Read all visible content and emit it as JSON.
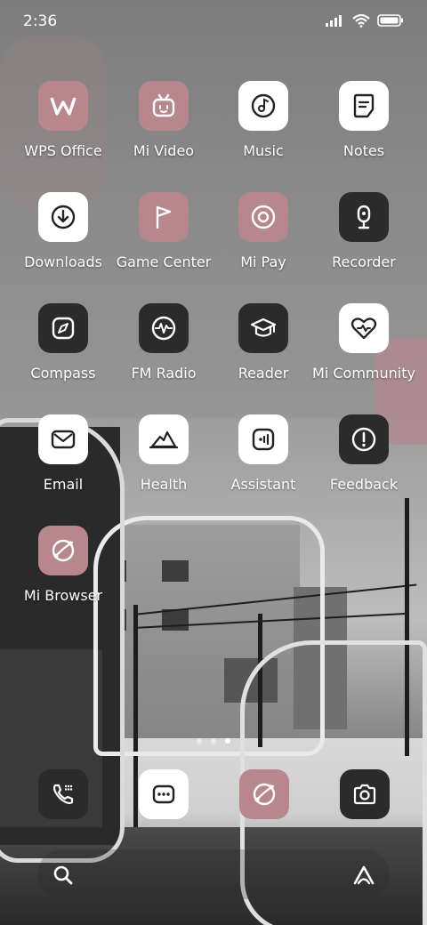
{
  "status_bar": {
    "time": "2:36"
  },
  "apps": [
    {
      "label": "WPS Office",
      "icon": "wps-office-icon",
      "style": "pink"
    },
    {
      "label": "Mi Video",
      "icon": "mi-video-icon",
      "style": "pink"
    },
    {
      "label": "Music",
      "icon": "music-icon",
      "style": "white"
    },
    {
      "label": "Notes",
      "icon": "notes-icon",
      "style": "white"
    },
    {
      "label": "Downloads",
      "icon": "downloads-icon",
      "style": "white"
    },
    {
      "label": "Game Center",
      "icon": "game-center-icon",
      "style": "pink"
    },
    {
      "label": "Mi Pay",
      "icon": "mi-pay-icon",
      "style": "pink"
    },
    {
      "label": "Recorder",
      "icon": "recorder-icon",
      "style": "dark"
    },
    {
      "label": "Compass",
      "icon": "compass-icon",
      "style": "dark"
    },
    {
      "label": "FM Radio",
      "icon": "fm-radio-icon",
      "style": "dark"
    },
    {
      "label": "Reader",
      "icon": "reader-icon",
      "style": "dark"
    },
    {
      "label": "Mi Community",
      "icon": "mi-community-icon",
      "style": "white"
    },
    {
      "label": "Email",
      "icon": "email-icon",
      "style": "white"
    },
    {
      "label": "Health",
      "icon": "health-icon",
      "style": "white"
    },
    {
      "label": "Assistant",
      "icon": "assistant-icon",
      "style": "white"
    },
    {
      "label": "Feedback",
      "icon": "feedback-icon",
      "style": "dark"
    },
    {
      "label": "Mi Browser",
      "icon": "mi-browser-icon",
      "style": "pink"
    }
  ],
  "page_indicator": {
    "pages": 3,
    "active_index": 2
  },
  "dock": [
    {
      "icon": "phone-icon",
      "style": "dark"
    },
    {
      "icon": "messaging-icon",
      "style": "white"
    },
    {
      "icon": "browser-icon",
      "style": "pink"
    },
    {
      "icon": "camera-icon",
      "style": "dark"
    }
  ],
  "search_bar": {
    "left_icon": "search-icon",
    "right_icon": "assistant-logo-icon"
  },
  "colors": {
    "pink": "#b8878d",
    "white": "#ffffff",
    "dark": "#2b2b2b"
  }
}
